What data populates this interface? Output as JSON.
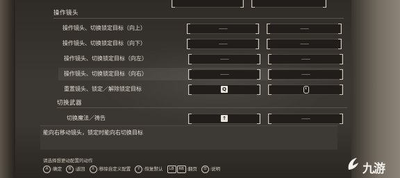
{
  "sections": {
    "camera": {
      "title": "操作镜头"
    },
    "weapon": {
      "title": "切换武器"
    }
  },
  "rows": [
    {
      "label": "操作镜头、切换锁定目标（向上）",
      "slot1": "——",
      "slot2": "——"
    },
    {
      "label": "操作镜头、切换锁定目标（向下）",
      "slot1": "——",
      "slot2": "——"
    },
    {
      "label": "操作镜头、切换锁定目标（向左）",
      "slot1": "——",
      "slot2": "——"
    },
    {
      "label": "操作镜头、切换锁定目标（向右）",
      "slot1": "——",
      "slot2": "——"
    },
    {
      "label": "重置镜头、锁定／解除锁定目标",
      "slot1_key": "Q",
      "slot2_icon": "mouse-icon"
    },
    {
      "label": "切换魔法／祷告",
      "slot1_key": "↑",
      "slot2": "——"
    }
  ],
  "description": "能向右移动镜头，锁定时能向右切换目标",
  "prompt": "请选择想更动配置的动作",
  "hints": [
    {
      "button": "A",
      "label": "确定"
    },
    {
      "button": "B",
      "label": "返回"
    },
    {
      "button": "X",
      "label": "移除自定义配置"
    },
    {
      "button": "Y",
      "label": "恢复默认"
    },
    {
      "button": "LB",
      "label": ""
    },
    {
      "button": "RB",
      "label": "翻页"
    },
    {
      "button": "☰",
      "label": "说明"
    }
  ],
  "watermark": {
    "text": "九游",
    "icon": "jiuyou-logo-icon"
  }
}
